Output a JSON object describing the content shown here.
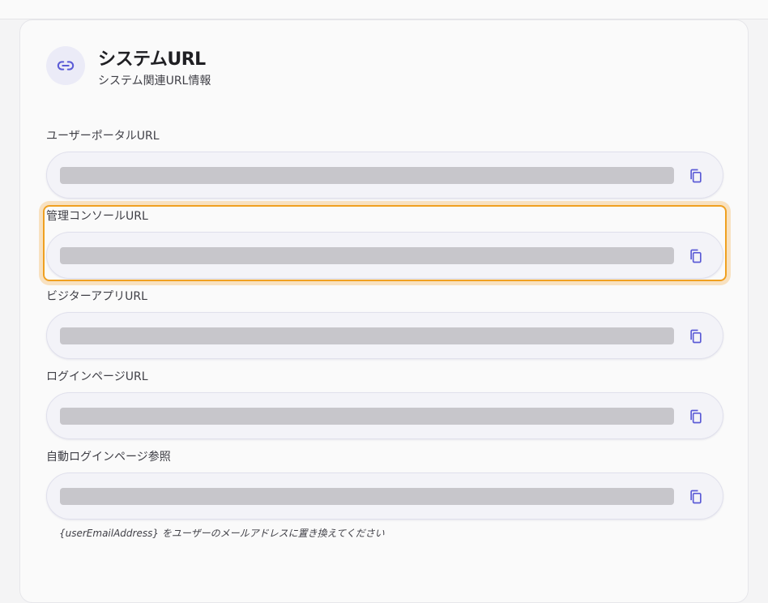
{
  "header": {
    "title": "システムURL",
    "subtitle": "システム関連URL情報",
    "icon": "link-icon"
  },
  "fields": [
    {
      "label": "ユーザーポータルURL",
      "value": "",
      "copy_icon": "copy-icon"
    },
    {
      "label": "管理コンソールURL",
      "value": "",
      "copy_icon": "copy-icon",
      "focused": true
    },
    {
      "label": "ビジターアプリURL",
      "value": "",
      "copy_icon": "copy-icon"
    },
    {
      "label": "ログインページURL",
      "value": "",
      "copy_icon": "copy-icon"
    },
    {
      "label": "自動ログインページ参照",
      "value": "",
      "copy_icon": "copy-icon"
    }
  ],
  "hint": "{userEmailAddress} をユーザーのメールアドレスに置き換えてください",
  "colors": {
    "accent": "#5b5bd6",
    "focus": "#f0a020",
    "placeholder_bar": "#c7c6cb"
  }
}
